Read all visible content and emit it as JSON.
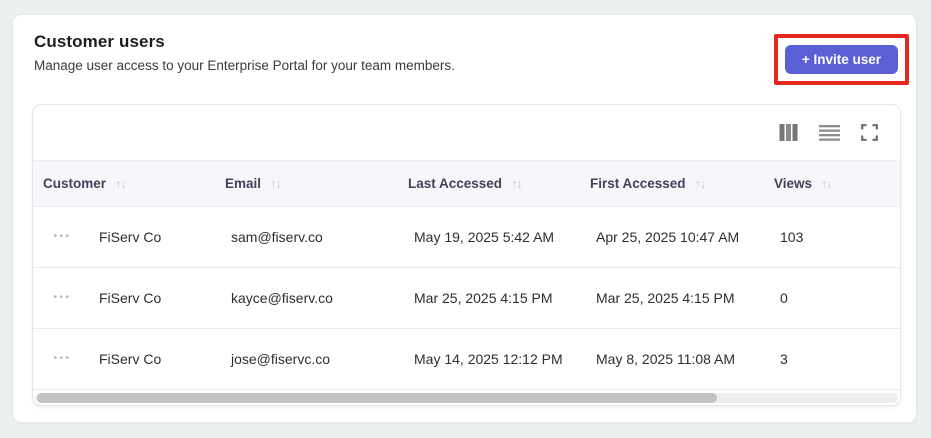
{
  "page": {
    "title": "Customer users",
    "subtitle": "Manage user access to your Enterprise Portal for your team members."
  },
  "actions": {
    "invite_button_label": "+ Invite user"
  },
  "toolbar": {
    "icons": [
      "columns-icon",
      "row-height-icon",
      "fullscreen-icon"
    ]
  },
  "table": {
    "sort_icon": "↑↓",
    "row_menu_icon": "•••",
    "columns": [
      {
        "label": "Customer"
      },
      {
        "label": "Email"
      },
      {
        "label": "Last Accessed"
      },
      {
        "label": "First Accessed"
      },
      {
        "label": "Views"
      }
    ],
    "rows": [
      {
        "customer": "FiServ Co",
        "email": "sam@fiserv.co",
        "last_accessed": "May 19, 2025 5:42 AM",
        "first_accessed": "Apr 25, 2025 10:47 AM",
        "views": "103"
      },
      {
        "customer": "FiServ Co",
        "email": "kayce@fiserv.co",
        "last_accessed": "Mar 25, 2025 4:15 PM",
        "first_accessed": "Mar 25, 2025 4:15 PM",
        "views": "0"
      },
      {
        "customer": "FiServ Co",
        "email": "jose@fiservc.co",
        "last_accessed": "May 14, 2025 12:12 PM",
        "first_accessed": "May 8, 2025 11:08 AM",
        "views": "3"
      }
    ]
  },
  "colors": {
    "accent": "#5a5fd6",
    "highlight_red": "#e7261d",
    "header_bg": "#f7f7fb",
    "page_bg": "#edf0f0"
  }
}
